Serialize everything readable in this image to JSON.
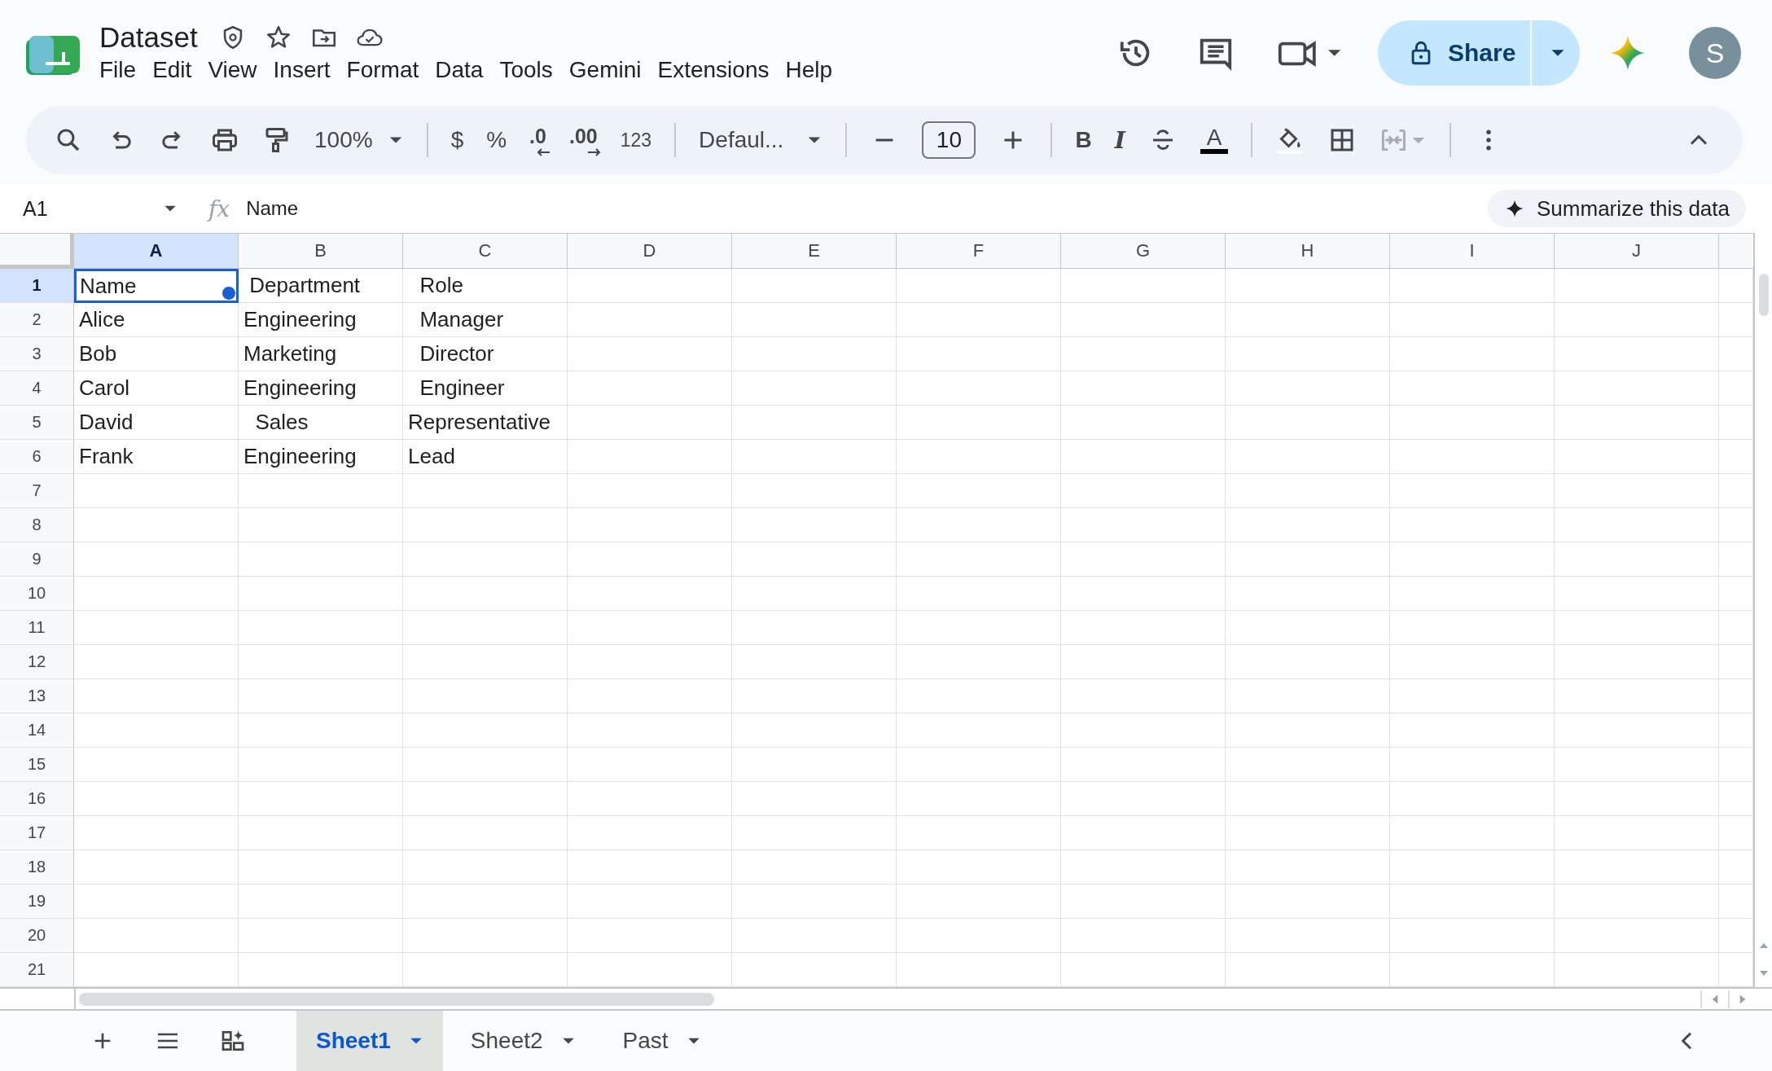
{
  "document": {
    "title": "Dataset"
  },
  "menu": [
    "File",
    "Edit",
    "View",
    "Insert",
    "Format",
    "Data",
    "Tools",
    "Gemini",
    "Extensions",
    "Help"
  ],
  "share": {
    "label": "Share"
  },
  "avatar": {
    "initial": "S"
  },
  "toolbar": {
    "zoom": "100%",
    "currency": "$",
    "percent": "%",
    "decrease_decimal": ".0",
    "increase_decimal": ".00",
    "number_format": "123",
    "font": "Defaul...",
    "font_size": "10",
    "bold": "B",
    "italic": "I",
    "text_color": "A"
  },
  "formula_bar": {
    "cell_ref": "A1",
    "fx": "fx",
    "value": "Name"
  },
  "summarize": {
    "label": "Summarize this data"
  },
  "table": {
    "columns": [
      {
        "label": "A",
        "selected": true
      },
      {
        "label": "B",
        "selected": false
      },
      {
        "label": "C",
        "selected": false
      },
      {
        "label": "D",
        "selected": false
      },
      {
        "label": "E",
        "selected": false
      },
      {
        "label": "F",
        "selected": false
      },
      {
        "label": "G",
        "selected": false
      },
      {
        "label": "H",
        "selected": false
      },
      {
        "label": "I",
        "selected": false
      },
      {
        "label": "J",
        "selected": false
      }
    ],
    "rows": [
      {
        "header": "1",
        "selected": true,
        "cells": [
          {
            "text": "Name",
            "selected": true
          },
          {
            "text": " Department",
            "selected": false
          },
          {
            "text": "  Role",
            "selected": false
          }
        ]
      },
      {
        "header": "2",
        "selected": false,
        "cells": [
          {
            "text": "Alice",
            "selected": false
          },
          {
            "text": "Engineering",
            "selected": false
          },
          {
            "text": "  Manager",
            "selected": false
          }
        ]
      },
      {
        "header": "3",
        "selected": false,
        "cells": [
          {
            "text": "Bob",
            "selected": false
          },
          {
            "text": "Marketing",
            "selected": false
          },
          {
            "text": "  Director",
            "selected": false
          }
        ]
      },
      {
        "header": "4",
        "selected": false,
        "cells": [
          {
            "text": "Carol",
            "selected": false
          },
          {
            "text": "Engineering",
            "selected": false
          },
          {
            "text": "  Engineer",
            "selected": false
          }
        ]
      },
      {
        "header": "5",
        "selected": false,
        "cells": [
          {
            "text": "David",
            "selected": false
          },
          {
            "text": "  Sales",
            "selected": false
          },
          {
            "text": "Representative",
            "selected": false
          }
        ]
      },
      {
        "header": "6",
        "selected": false,
        "cells": [
          {
            "text": "Frank",
            "selected": false
          },
          {
            "text": "Engineering",
            "selected": false
          },
          {
            "text": "Lead",
            "selected": false
          }
        ]
      },
      {
        "header": "7",
        "selected": false,
        "cells": []
      },
      {
        "header": "8",
        "selected": false,
        "cells": []
      },
      {
        "header": "9",
        "selected": false,
        "cells": []
      },
      {
        "header": "10",
        "selected": false,
        "cells": []
      },
      {
        "header": "11",
        "selected": false,
        "cells": []
      },
      {
        "header": "12",
        "selected": false,
        "cells": []
      },
      {
        "header": "13",
        "selected": false,
        "cells": []
      },
      {
        "header": "14",
        "selected": false,
        "cells": []
      },
      {
        "header": "15",
        "selected": false,
        "cells": []
      },
      {
        "header": "16",
        "selected": false,
        "cells": []
      },
      {
        "header": "17",
        "selected": false,
        "cells": []
      },
      {
        "header": "18",
        "selected": false,
        "cells": []
      },
      {
        "header": "19",
        "selected": false,
        "cells": []
      },
      {
        "header": "20",
        "selected": false,
        "cells": []
      },
      {
        "header": "21",
        "selected": false,
        "cells": []
      }
    ]
  },
  "sheet_tabs": [
    {
      "label": "Sheet1",
      "selected": true
    },
    {
      "label": "Sheet2",
      "selected": false
    },
    {
      "label": "Past",
      "selected": false
    }
  ]
}
